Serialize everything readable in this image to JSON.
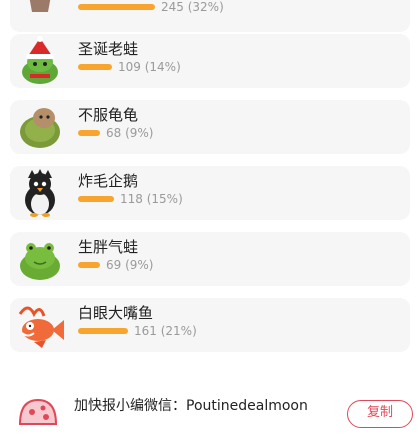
{
  "items": [
    {
      "name": "",
      "count": "245 (32%)",
      "fraction": 0.32,
      "icon": "potted-plant-plush"
    },
    {
      "name": "圣诞老蛙",
      "count": "109 (14%)",
      "fraction": 0.14,
      "icon": "santa-frog-plush"
    },
    {
      "name": "不服龟龟",
      "count": "68 (9%)",
      "fraction": 0.09,
      "icon": "turtle-plush"
    },
    {
      "name": "炸毛企鹅",
      "count": "118 (15%)",
      "fraction": 0.15,
      "icon": "penguin-plush"
    },
    {
      "name": "生胖气蛙",
      "count": "69 (9%)",
      "fraction": 0.09,
      "icon": "frog-plush"
    },
    {
      "name": "白眼大嘴鱼",
      "count": "161 (21%)",
      "fraction": 0.21,
      "icon": "fish-plush"
    }
  ],
  "footer": {
    "text": "加快报小编微信：Poutinedealmoon",
    "copy_label": "复制"
  },
  "colors": {
    "bar": "#f7a52f",
    "accent": "#e0485a"
  }
}
